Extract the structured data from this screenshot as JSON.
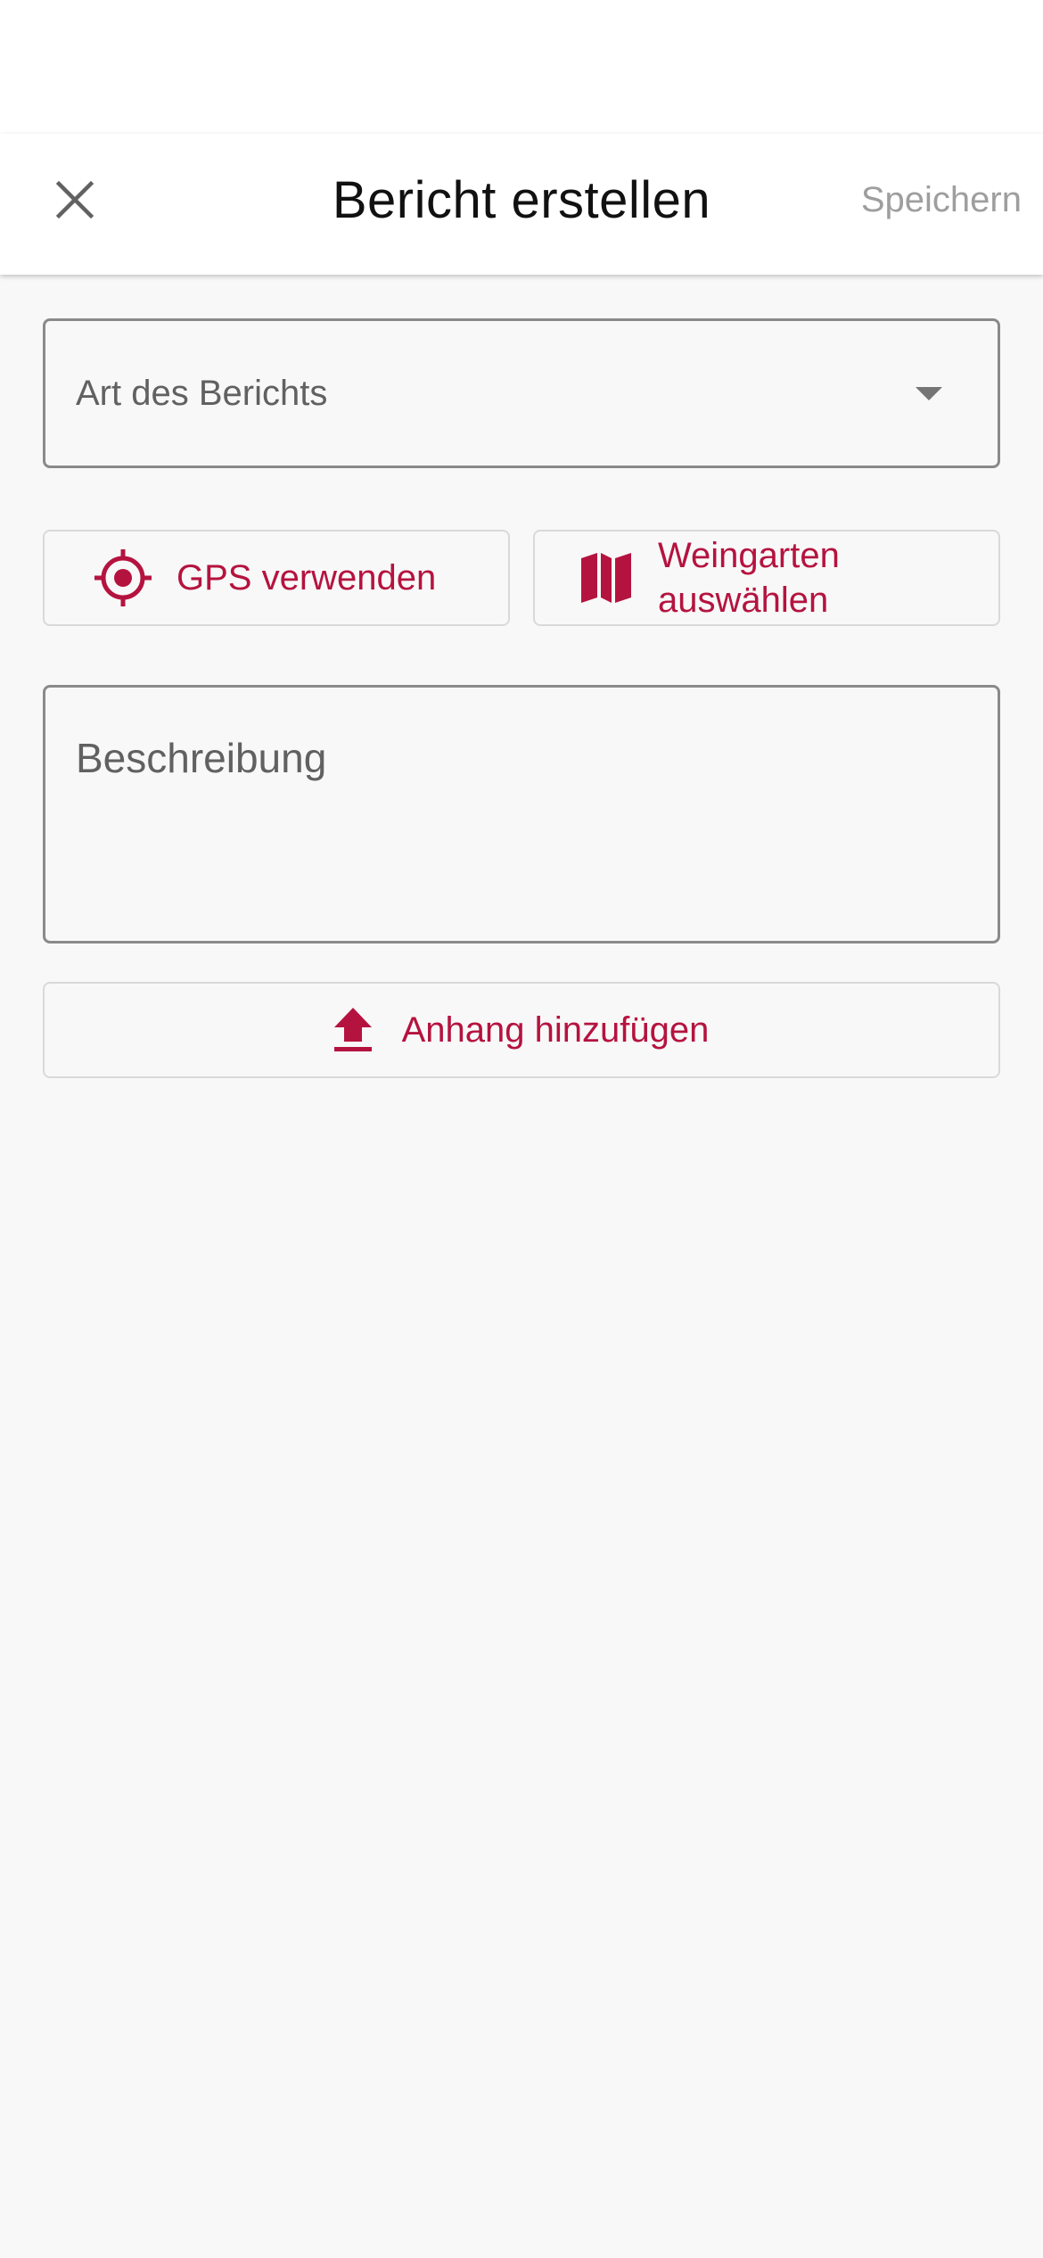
{
  "header": {
    "title": "Bericht erstellen",
    "save_label": "Speichern",
    "close_icon": "close-icon"
  },
  "form": {
    "report_type": {
      "label": "Art des Berichts",
      "icon": "dropdown-arrow-icon"
    },
    "gps_button": {
      "label": "GPS verwenden",
      "icon": "gps-target-icon"
    },
    "vineyard_button": {
      "label_line1": "Weingarten",
      "label_line2": "auswählen",
      "icon": "map-icon"
    },
    "description": {
      "label": "Beschreibung"
    },
    "attach_button": {
      "label": "Anhang hinzufügen",
      "icon": "upload-icon"
    }
  },
  "colors": {
    "accent": "#b5133f",
    "muted_text": "#616161",
    "disabled_text": "#9e9e9e",
    "background": "#f8f8f8"
  }
}
